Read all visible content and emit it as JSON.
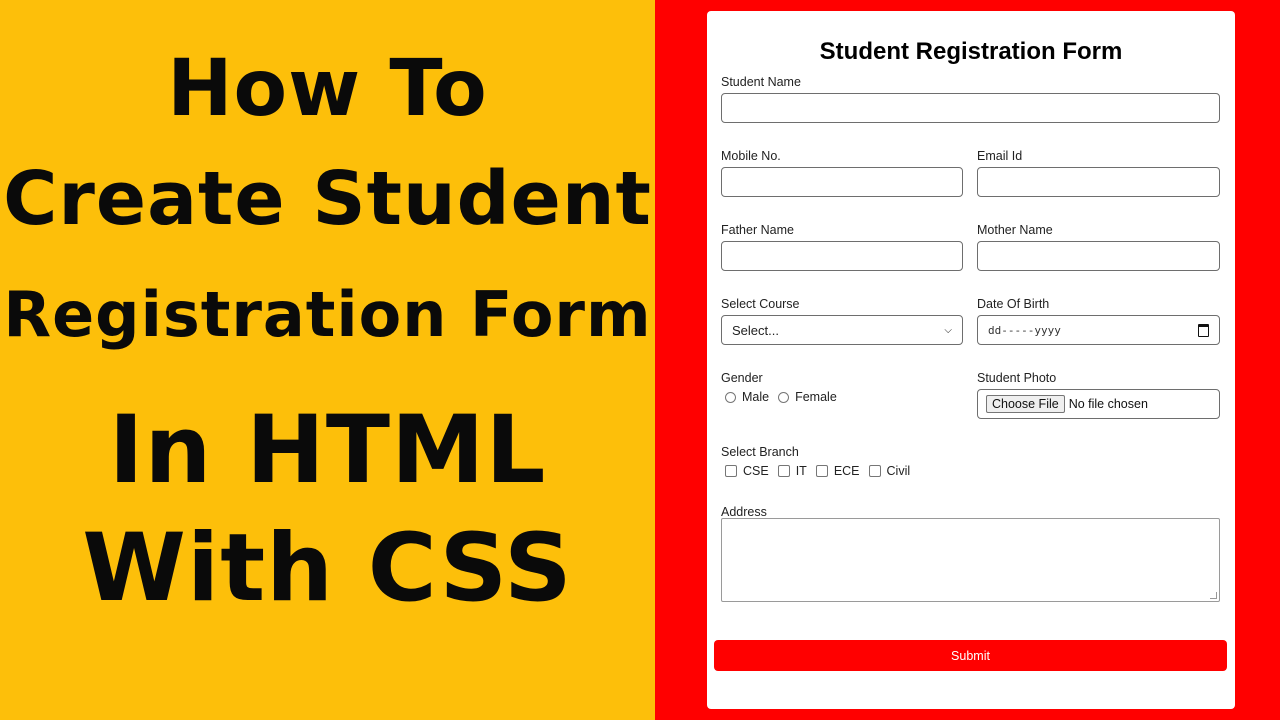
{
  "thumbnail": {
    "headline_lines": [
      "How To",
      "Create Student",
      "Registration Form",
      "In HTML",
      "With CSS"
    ],
    "colors": {
      "left_bg": "#fdbf0a",
      "right_bg": "#ff0000",
      "submit_bg": "#ff0000"
    }
  },
  "form": {
    "title": "Student Registration Form",
    "student_name": {
      "label": "Student Name",
      "value": ""
    },
    "mobile": {
      "label": "Mobile No.",
      "value": ""
    },
    "email": {
      "label": "Email Id",
      "value": ""
    },
    "father_name": {
      "label": "Father Name",
      "value": ""
    },
    "mother_name": {
      "label": "Mother Name",
      "value": ""
    },
    "course": {
      "label": "Select Course",
      "selected": "Select..."
    },
    "dob": {
      "label": "Date Of Birth",
      "placeholder": "dd-----yyyy"
    },
    "gender": {
      "label": "Gender",
      "options": [
        "Male",
        "Female"
      ]
    },
    "photo": {
      "label": "Student Photo",
      "button": "Choose File",
      "status": "No file chosen"
    },
    "branch": {
      "label": "Select Branch",
      "options": [
        "CSE",
        "IT",
        "ECE",
        "Civil"
      ]
    },
    "address": {
      "label": "Address",
      "value": ""
    },
    "submit_label": "Submit"
  }
}
